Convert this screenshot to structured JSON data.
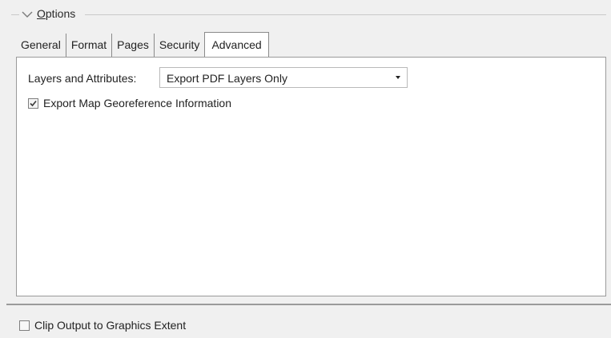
{
  "group": {
    "title_mnemonic": "O",
    "title_rest": "ptions",
    "expanded": true
  },
  "tabs": [
    {
      "label": "General",
      "active": false
    },
    {
      "label": "Format",
      "active": false
    },
    {
      "label": "Pages",
      "active": false
    },
    {
      "label": "Security",
      "active": false
    },
    {
      "label": "Advanced",
      "active": true
    }
  ],
  "advanced": {
    "layers_label": "Layers and Attributes:",
    "layers_value": "Export PDF Layers Only",
    "georef_label": "Export Map Georeference Information",
    "georef_checked": true
  },
  "footer": {
    "clip_label": "Clip Output to Graphics Extent",
    "clip_checked": false
  },
  "icons": {
    "collapse": "chevron-down-icon",
    "dropdown": "dropdown-arrow-icon",
    "checkmark": "checkmark-icon"
  }
}
